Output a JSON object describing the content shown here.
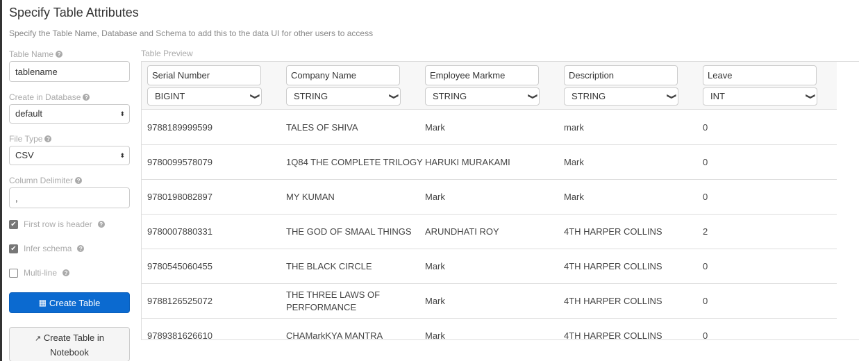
{
  "header": {
    "title": "Specify Table Attributes",
    "subtitle": "Specify the Table Name, Database and Schema to add this to the data UI for other users to access"
  },
  "form": {
    "table_name": {
      "label": "Table Name",
      "value": "tablename"
    },
    "database": {
      "label": "Create in Database",
      "value": "default"
    },
    "file_type": {
      "label": "File Type",
      "value": "CSV"
    },
    "delimiter": {
      "label": "Column Delimiter",
      "value": ","
    },
    "checkboxes": [
      {
        "label": "First row is header",
        "checked": true
      },
      {
        "label": "Infer schema",
        "checked": true
      },
      {
        "label": "Multi-line",
        "checked": false
      }
    ],
    "create_table_label": "Create Table",
    "create_notebook_label_line1": "Create Table in",
    "create_notebook_label_line2": "Notebook"
  },
  "icons": {
    "help": "?",
    "check": "✔",
    "select_arrows": "▲▼",
    "chevron": "⌄",
    "table": "▦",
    "external": "↗"
  },
  "preview": {
    "label": "Table Preview",
    "columns": [
      {
        "name": "Serial Number",
        "type": "BIGINT"
      },
      {
        "name": "Company Name",
        "type": "STRING"
      },
      {
        "name": "Employee Markme",
        "type": "STRING"
      },
      {
        "name": "Description",
        "type": "STRING"
      },
      {
        "name": "Leave",
        "type": "INT"
      }
    ],
    "rows": [
      [
        "9788189999599",
        "TALES OF SHIVA",
        "Mark",
        "mark",
        "0"
      ],
      [
        "9780099578079",
        "1Q84 THE COMPLETE TRILOGY",
        "HARUKI MURAKAMI",
        "Mark",
        "0"
      ],
      [
        "9780198082897",
        "MY KUMAN",
        "Mark",
        "Mark",
        "0"
      ],
      [
        "9780007880331",
        "THE GOD OF SMAAL THINGS",
        "ARUNDHATI ROY",
        "4TH HARPER COLLINS",
        "2"
      ],
      [
        "9780545060455",
        "THE BLACK CIRCLE",
        "Mark",
        "4TH HARPER COLLINS",
        "0"
      ],
      [
        "9788126525072",
        "THE THREE LAWS OF PERFORMANCE",
        "Mark",
        "4TH HARPER COLLINS",
        "0"
      ],
      [
        "9789381626610",
        "CHAMarkKYA MANTRA",
        "Mark",
        "4TH HARPER COLLINS",
        "0"
      ]
    ]
  },
  "colors": {
    "primary": "#0b6ad0",
    "muted_text": "#aaaaaa",
    "header_bg": "#f7f7f7"
  }
}
